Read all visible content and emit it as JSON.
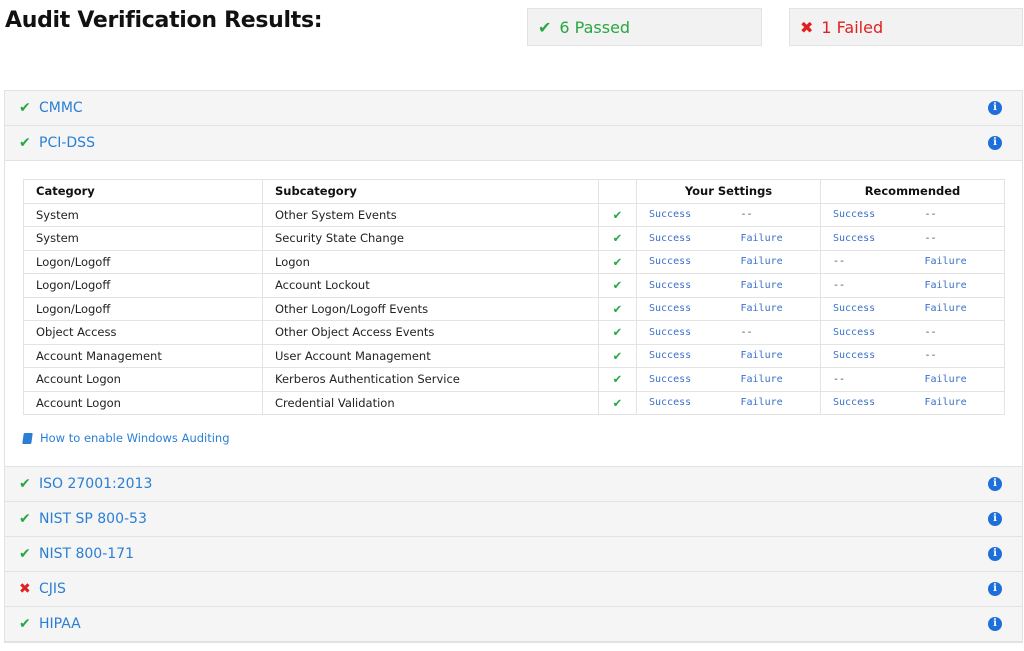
{
  "page_title": "Audit Verification Results:",
  "summary": {
    "passed_label": "6 Passed",
    "failed_label": "1 Failed",
    "passed_icon": "check-icon",
    "failed_icon": "x-icon",
    "passed_color": "#28a745",
    "failed_color": "#e02020"
  },
  "standards": [
    {
      "name": "CMMC",
      "status": "pass"
    },
    {
      "name": "PCI-DSS",
      "status": "pass",
      "expanded": true
    },
    {
      "name": "ISO 27001:2013",
      "status": "pass"
    },
    {
      "name": "NIST SP 800-53",
      "status": "pass"
    },
    {
      "name": "NIST 800-171",
      "status": "pass"
    },
    {
      "name": "CJIS",
      "status": "fail"
    },
    {
      "name": "HIPAA",
      "status": "pass"
    }
  ],
  "table": {
    "headers": {
      "category": "Category",
      "subcategory": "Subcategory",
      "your_settings": "Your Settings",
      "recommended": "Recommended"
    },
    "rows": [
      {
        "category": "System",
        "subcategory": "Other System Events",
        "your_success": "Success",
        "your_failure": "--",
        "rec_success": "Success",
        "rec_failure": "--"
      },
      {
        "category": "System",
        "subcategory": "Security State Change",
        "your_success": "Success",
        "your_failure": "Failure",
        "rec_success": "Success",
        "rec_failure": "--"
      },
      {
        "category": "Logon/Logoff",
        "subcategory": "Logon",
        "your_success": "Success",
        "your_failure": "Failure",
        "rec_success": "--",
        "rec_failure": "Failure"
      },
      {
        "category": "Logon/Logoff",
        "subcategory": "Account Lockout",
        "your_success": "Success",
        "your_failure": "Failure",
        "rec_success": "--",
        "rec_failure": "Failure"
      },
      {
        "category": "Logon/Logoff",
        "subcategory": "Other Logon/Logoff Events",
        "your_success": "Success",
        "your_failure": "Failure",
        "rec_success": "Success",
        "rec_failure": "Failure"
      },
      {
        "category": "Object Access",
        "subcategory": "Other Object Access Events",
        "your_success": "Success",
        "your_failure": "--",
        "rec_success": "Success",
        "rec_failure": "--"
      },
      {
        "category": "Account Management",
        "subcategory": "User Account Management",
        "your_success": "Success",
        "your_failure": "Failure",
        "rec_success": "Success",
        "rec_failure": "--"
      },
      {
        "category": "Account Logon",
        "subcategory": "Kerberos Authentication Service",
        "your_success": "Success",
        "your_failure": "Failure",
        "rec_success": "--",
        "rec_failure": "Failure"
      },
      {
        "category": "Account Logon",
        "subcategory": "Credential Validation",
        "your_success": "Success",
        "your_failure": "Failure",
        "rec_success": "Success",
        "rec_failure": "Failure"
      }
    ]
  },
  "help_link": {
    "icon": "book-icon",
    "label": "How to enable Windows Auditing"
  }
}
